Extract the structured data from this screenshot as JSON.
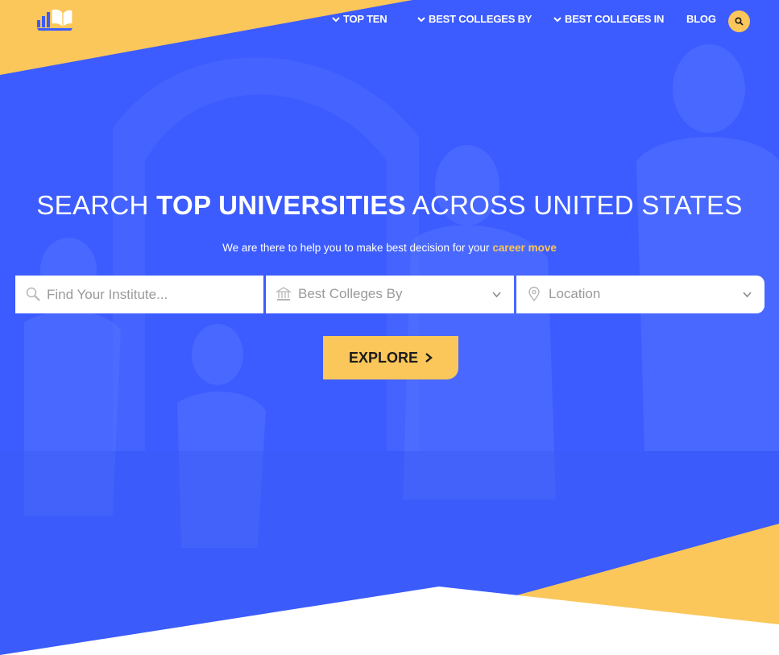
{
  "colors": {
    "brand_blue": "#3c5cff",
    "accent_yellow": "#fbc65a"
  },
  "nav": {
    "items": [
      {
        "label": "TOP TEN",
        "has_dropdown": true
      },
      {
        "label": "BEST COLLEGES BY",
        "has_dropdown": true
      },
      {
        "label": "BEST COLLEGES IN",
        "has_dropdown": true
      },
      {
        "label": "BLOG",
        "has_dropdown": false
      }
    ],
    "search_icon": "search-icon"
  },
  "hero": {
    "headline_pre": "SEARCH ",
    "headline_bold": "TOP UNIVERSITIES",
    "headline_post": " ACROSS UNITED STATES",
    "sub_pre": "We are there to help you to make best decision for your ",
    "sub_accent": "career move"
  },
  "search": {
    "institute_placeholder": "Find Your Institute...",
    "colleges_by_value": "Best Colleges By",
    "location_value": "Location"
  },
  "explore_label": "EXPLORE"
}
